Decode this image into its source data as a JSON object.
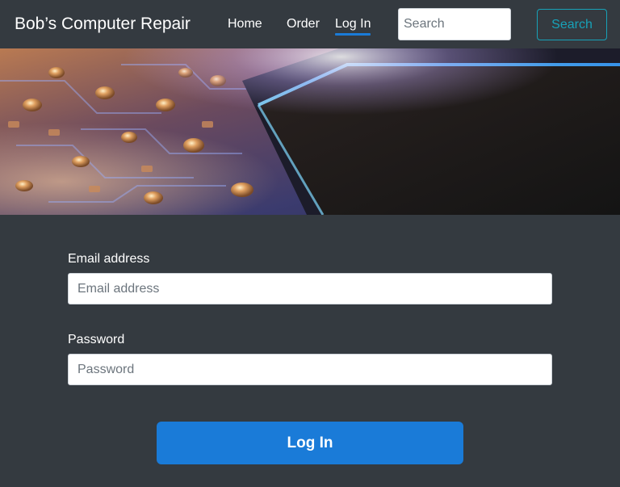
{
  "navbar": {
    "brand": "Bob’s Computer Repair",
    "links": [
      {
        "label": "Home",
        "active": false
      },
      {
        "label": "Order",
        "active": false
      },
      {
        "label": "Log In",
        "active": true
      }
    ],
    "search_placeholder": "Search",
    "search_button": "Search"
  },
  "hero": {
    "image": "circuit-board-photo"
  },
  "form": {
    "email_label": "Email address",
    "email_placeholder": "Email address",
    "password_label": "Password",
    "password_placeholder": "Password",
    "submit_label": "Log In"
  },
  "colors": {
    "background": "#343a40",
    "accent": "#1a7bd8",
    "search_outline": "#17a2b8"
  }
}
